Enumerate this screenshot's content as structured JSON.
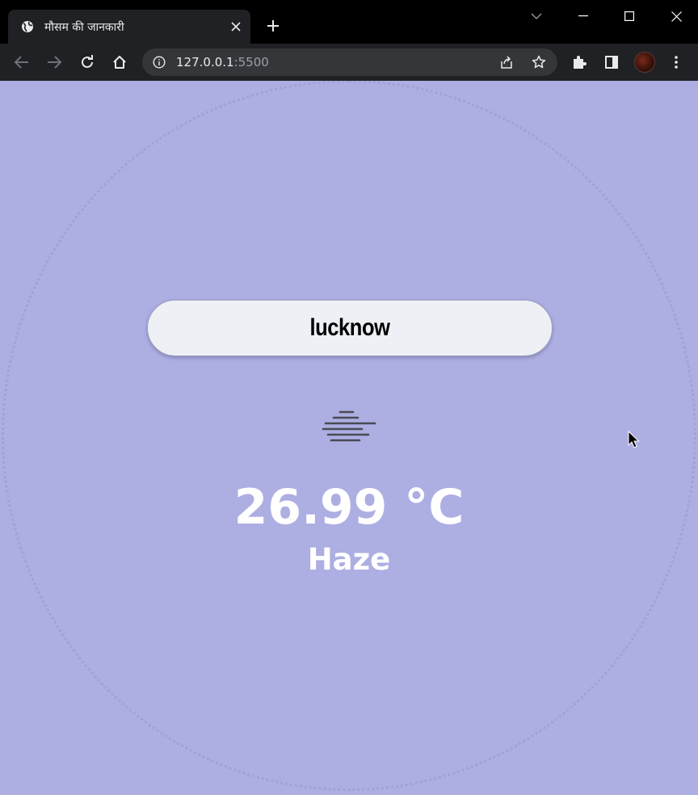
{
  "browser": {
    "tab": {
      "title": "मौसम की जानकारी",
      "favicon": "globe-icon"
    },
    "omnibox": {
      "host": "127.0.0.1",
      "port": ":5500",
      "info_icon": "info-icon"
    },
    "icons": {
      "back": "arrow-left-icon",
      "forward": "arrow-right-icon",
      "reload": "reload-icon",
      "home": "home-icon",
      "share": "share-icon",
      "bookmark": "star-icon",
      "extensions": "puzzle-icon",
      "side_panel": "side-panel-icon",
      "menu": "kebab-menu-icon"
    },
    "colors": {
      "tabstrip": "#000000",
      "toolbar": "#202124",
      "omnibox": "#35363a"
    }
  },
  "page": {
    "background_color": "#adaee2",
    "search": {
      "value": "lucknow"
    },
    "weather": {
      "icon": "haze-icon",
      "temperature": "26.99 °C",
      "condition": "Haze"
    }
  }
}
